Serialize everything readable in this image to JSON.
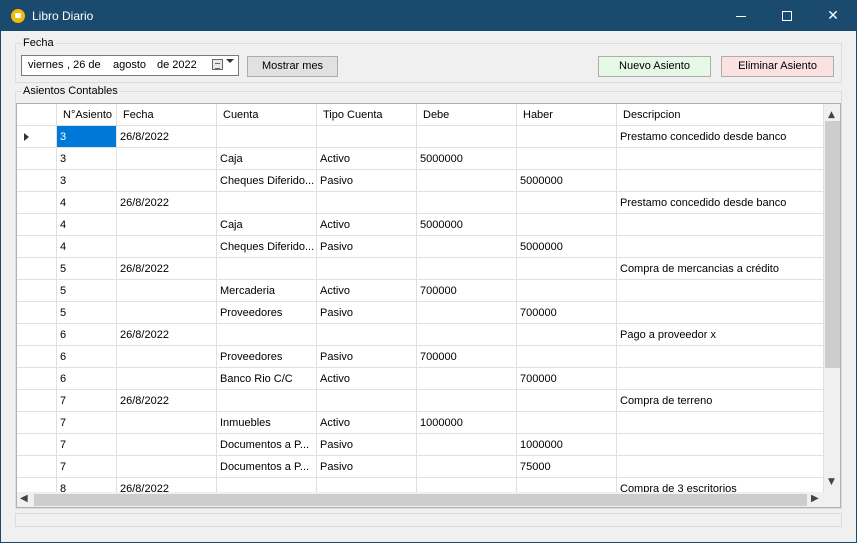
{
  "window": {
    "title": "Libro Diario",
    "minimize_glyph": "minimize-icon",
    "maximize_glyph": "maximize-icon",
    "close_label": "✕"
  },
  "fecha": {
    "group_label": "Fecha",
    "day_name": "viernes",
    "day_number": ", 26 de",
    "month": "agosto",
    "year": "de 2022",
    "show_month_button": "Mostrar mes"
  },
  "actions": {
    "new_entry": "Nuevo Asiento",
    "delete_entry": "Eliminar Asiento"
  },
  "asientos": {
    "group_label": "Asientos Contables",
    "columns": [
      "N°Asiento",
      "Fecha",
      "Cuenta",
      "Tipo Cuenta",
      "Debe",
      "Haber",
      "Descripcion"
    ],
    "rows": [
      {
        "asiento": "3",
        "fecha": "26/8/2022",
        "cuenta": "",
        "tipo": "",
        "debe": "",
        "haber": "",
        "descripcion": "Prestamo concedido desde banco"
      },
      {
        "asiento": "3",
        "fecha": "",
        "cuenta": "Caja",
        "tipo": "Activo",
        "debe": "5000000",
        "haber": "",
        "descripcion": ""
      },
      {
        "asiento": "3",
        "fecha": "",
        "cuenta": "Cheques Diferido...",
        "tipo": "Pasivo",
        "debe": "",
        "haber": "5000000",
        "descripcion": ""
      },
      {
        "asiento": "4",
        "fecha": "26/8/2022",
        "cuenta": "",
        "tipo": "",
        "debe": "",
        "haber": "",
        "descripcion": "Prestamo concedido desde banco"
      },
      {
        "asiento": "4",
        "fecha": "",
        "cuenta": "Caja",
        "tipo": "Activo",
        "debe": "5000000",
        "haber": "",
        "descripcion": ""
      },
      {
        "asiento": "4",
        "fecha": "",
        "cuenta": "Cheques Diferido...",
        "tipo": "Pasivo",
        "debe": "",
        "haber": "5000000",
        "descripcion": ""
      },
      {
        "asiento": "5",
        "fecha": "26/8/2022",
        "cuenta": "",
        "tipo": "",
        "debe": "",
        "haber": "",
        "descripcion": "Compra de mercancias a crédito"
      },
      {
        "asiento": "5",
        "fecha": "",
        "cuenta": "Mercaderia",
        "tipo": "Activo",
        "debe": "700000",
        "haber": "",
        "descripcion": ""
      },
      {
        "asiento": "5",
        "fecha": "",
        "cuenta": "Proveedores",
        "tipo": "Pasivo",
        "debe": "",
        "haber": "700000",
        "descripcion": ""
      },
      {
        "asiento": "6",
        "fecha": "26/8/2022",
        "cuenta": "",
        "tipo": "",
        "debe": "",
        "haber": "",
        "descripcion": "Pago a proveedor x"
      },
      {
        "asiento": "6",
        "fecha": "",
        "cuenta": "Proveedores",
        "tipo": "Pasivo",
        "debe": "700000",
        "haber": "",
        "descripcion": ""
      },
      {
        "asiento": "6",
        "fecha": "",
        "cuenta": "Banco Rio C/C",
        "tipo": "Activo",
        "debe": "",
        "haber": "700000",
        "descripcion": ""
      },
      {
        "asiento": "7",
        "fecha": "26/8/2022",
        "cuenta": "",
        "tipo": "",
        "debe": "",
        "haber": "",
        "descripcion": "Compra de terreno"
      },
      {
        "asiento": "7",
        "fecha": "",
        "cuenta": "Inmuebles",
        "tipo": "Activo",
        "debe": "1000000",
        "haber": "",
        "descripcion": ""
      },
      {
        "asiento": "7",
        "fecha": "",
        "cuenta": "Documentos a P...",
        "tipo": "Pasivo",
        "debe": "",
        "haber": "1000000",
        "descripcion": ""
      },
      {
        "asiento": "7",
        "fecha": "",
        "cuenta": "Documentos a P...",
        "tipo": "Pasivo",
        "debe": "",
        "haber": "75000",
        "descripcion": ""
      },
      {
        "asiento": "8",
        "fecha": "26/8/2022",
        "cuenta": "",
        "tipo": "",
        "debe": "",
        "haber": "",
        "descripcion": "Compra de 3 escritorios"
      }
    ],
    "selected_row": 0,
    "selected_column": "asiento"
  },
  "colors": {
    "titlebar": "#1a4a6e",
    "selection": "#0078d7",
    "new_button_bg": "#e6f8e6",
    "delete_button_bg": "#fbe2e2"
  }
}
